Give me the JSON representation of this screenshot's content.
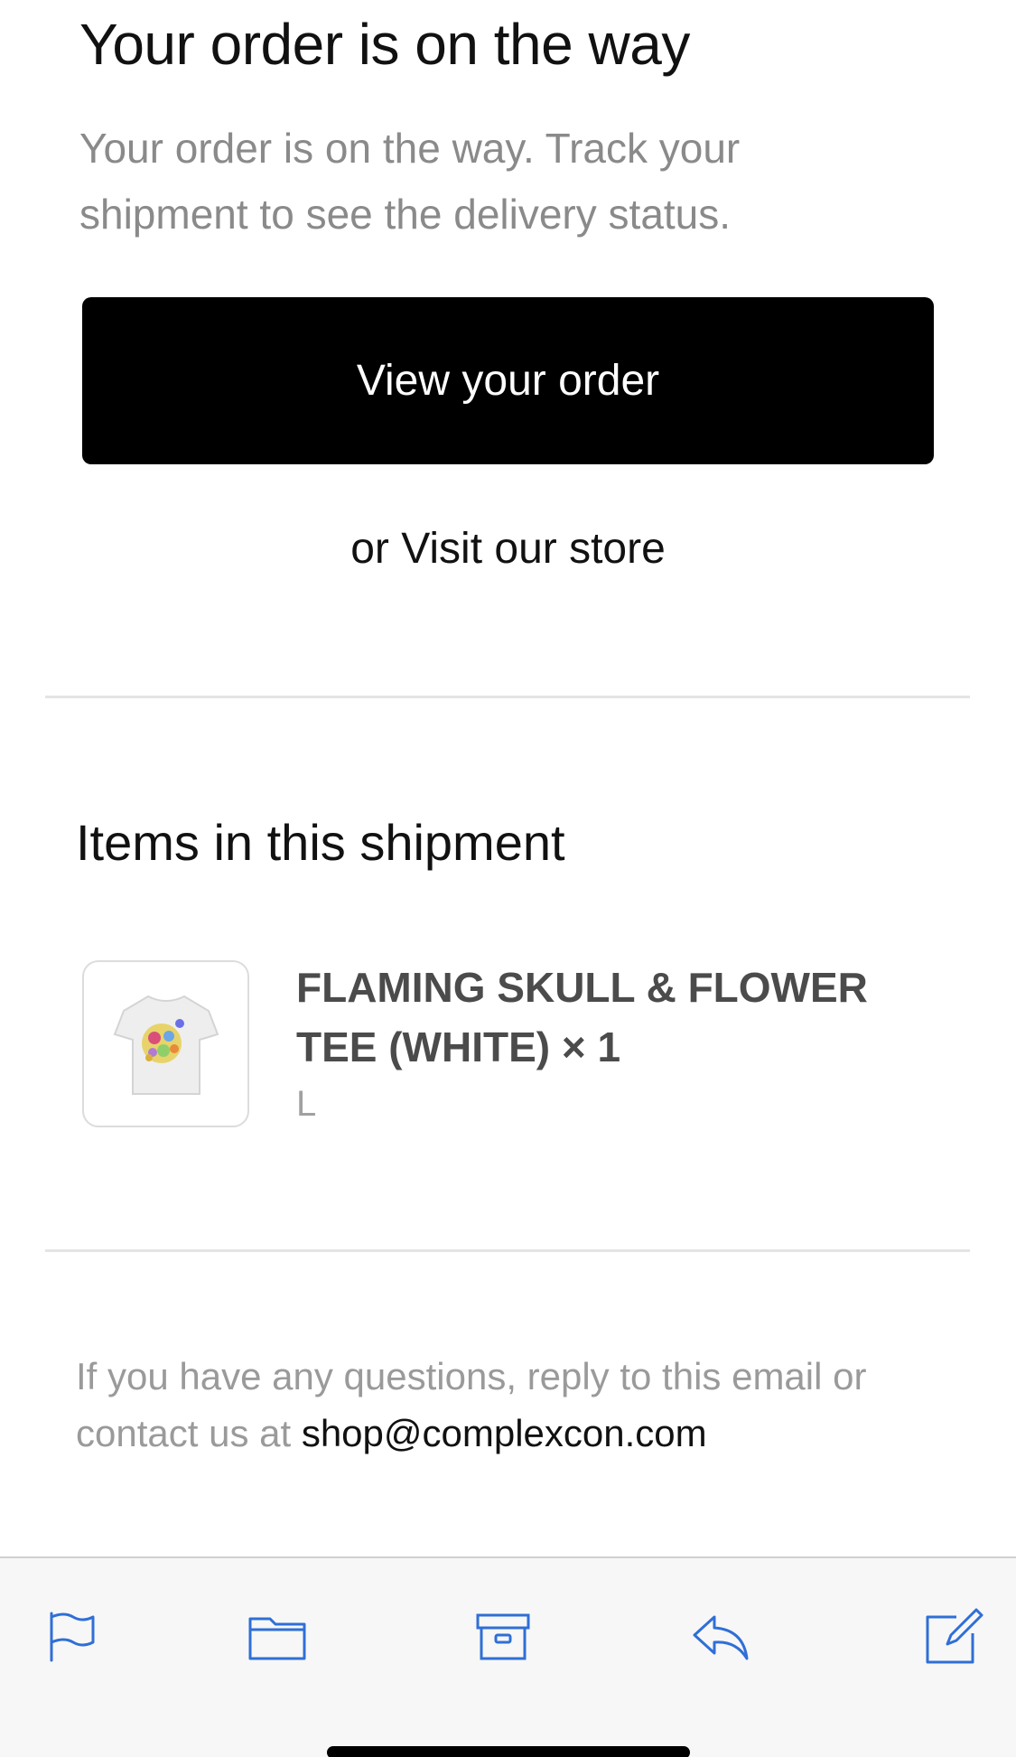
{
  "header": {
    "title": "Your order is on the way",
    "subtitle": "Your order is on the way. Track your shipment to see the delivery status."
  },
  "actions": {
    "view_order_label": "View your order",
    "or_text": "or ",
    "visit_store_label": "Visit our store"
  },
  "shipment": {
    "heading": "Items in this shipment",
    "items": [
      {
        "name": "FLAMING SKULL & FLOWER TEE (WHITE) × 1",
        "variant": "L",
        "image_icon": "tshirt-thumbnail"
      }
    ]
  },
  "footer": {
    "text": "If you have any questions, reply to this email or contact us at ",
    "email": "shop@complexcon.com"
  },
  "toolbar": {
    "icons": [
      "flag-icon",
      "folder-icon",
      "archive-icon",
      "reply-icon",
      "compose-icon"
    ],
    "accent_color": "#2f6fd6"
  },
  "colors": {
    "cta_background": "#000000",
    "cta_text": "#ffffff",
    "muted_text": "#8a8a8a"
  }
}
